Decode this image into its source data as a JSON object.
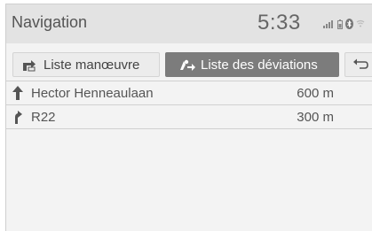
{
  "header": {
    "title": "Navigation",
    "clock": "5:33",
    "status_icons": [
      "signal-icon",
      "phone-battery-icon",
      "bluetooth-icon",
      "wifi-icon"
    ]
  },
  "tabs": [
    {
      "label": "Liste manœuvre",
      "icon": "turn-list-icon",
      "active": false
    },
    {
      "label": "Liste des déviations",
      "icon": "detour-icon",
      "active": true
    },
    {
      "label": "",
      "icon": "back-icon",
      "active": false
    }
  ],
  "list": {
    "rows": [
      {
        "name": "Hector Henneaulaan",
        "distance": "600 m",
        "icon": "straight-arrow-icon"
      },
      {
        "name": "R22",
        "distance": "300 m",
        "icon": "keep-right-arrow-icon"
      }
    ]
  },
  "colors": {
    "active_tab": "#7c7c7c",
    "header_bg": "#e3e3e3",
    "screen_bg": "#f3f3f3"
  }
}
